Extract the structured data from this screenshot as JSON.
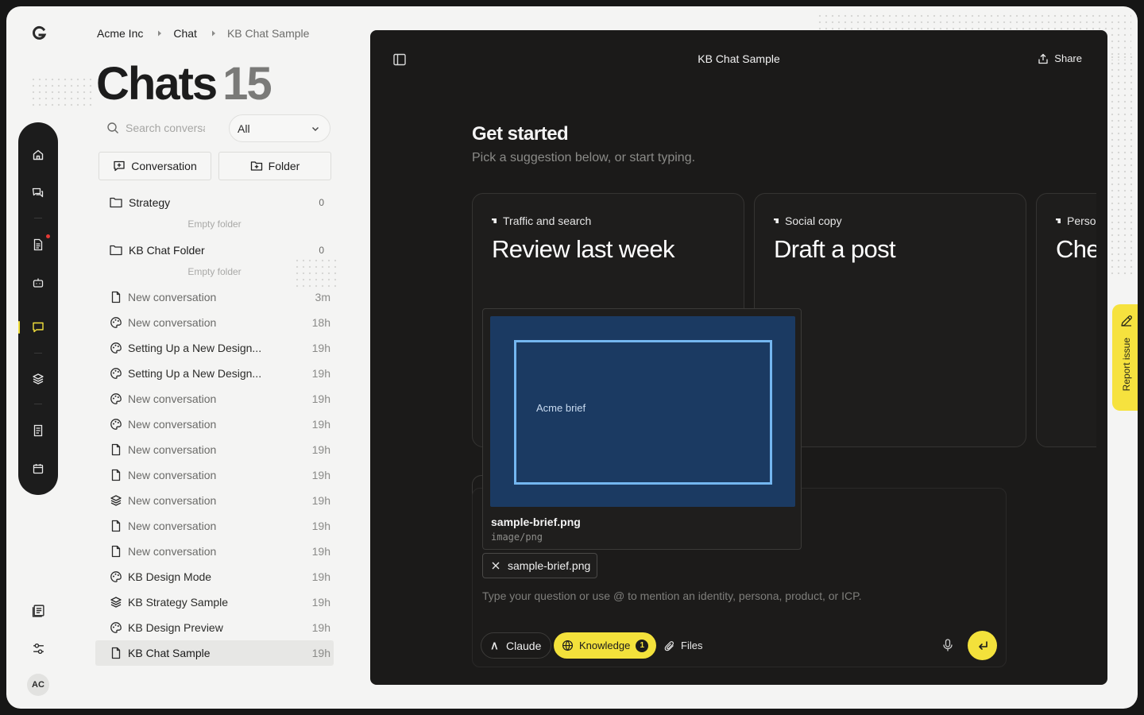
{
  "breadcrumb": {
    "org": "Acme Inc",
    "section": "Chat",
    "current": "KB Chat Sample"
  },
  "page": {
    "title": "Chats",
    "count": "15"
  },
  "search": {
    "placeholder": "Search conversations",
    "value": ""
  },
  "filter": {
    "selected": "All"
  },
  "buttons": {
    "conversation": "Conversation",
    "folder": "Folder"
  },
  "folders": [
    {
      "name": "Strategy",
      "count": "0",
      "empty_label": "Empty folder"
    },
    {
      "name": "KB Chat Folder",
      "count": "0",
      "empty_label": "Empty folder"
    }
  ],
  "conversations": [
    {
      "name": "New conversation",
      "time": "3m",
      "icon": "document-icon"
    },
    {
      "name": "New conversation",
      "time": "18h",
      "icon": "palette-icon"
    },
    {
      "name": "Setting Up a New Design...",
      "time": "19h",
      "icon": "palette-icon"
    },
    {
      "name": "Setting Up a New Design...",
      "time": "19h",
      "icon": "palette-icon"
    },
    {
      "name": "New conversation",
      "time": "19h",
      "icon": "palette-icon"
    },
    {
      "name": "New conversation",
      "time": "19h",
      "icon": "palette-icon"
    },
    {
      "name": "New conversation",
      "time": "19h",
      "icon": "document-icon"
    },
    {
      "name": "New conversation",
      "time": "19h",
      "icon": "document-icon"
    },
    {
      "name": "New conversation",
      "time": "19h",
      "icon": "layers-icon"
    },
    {
      "name": "New conversation",
      "time": "19h",
      "icon": "document-icon"
    },
    {
      "name": "New conversation",
      "time": "19h",
      "icon": "document-icon"
    },
    {
      "name": "KB Design Mode",
      "time": "19h",
      "icon": "palette-icon"
    },
    {
      "name": "KB Strategy Sample",
      "time": "19h",
      "icon": "layers-icon"
    },
    {
      "name": "KB Design Preview",
      "time": "19h",
      "icon": "palette-icon"
    },
    {
      "name": "KB Chat Sample",
      "time": "19h",
      "icon": "document-icon"
    }
  ],
  "user": {
    "initials": "AC"
  },
  "panel": {
    "title": "KB Chat Sample",
    "share_label": "Share",
    "get_started": "Get started",
    "subtitle": "Pick a suggestion below, or start typing.",
    "cards": [
      {
        "tag": "Traffic and search",
        "title": "Review last week"
      },
      {
        "tag": "Social copy",
        "title": "Draft a post"
      },
      {
        "tag": "Persona",
        "title": "Check"
      }
    ]
  },
  "attachment": {
    "file_name": "sample-brief.png",
    "mime": "image/png",
    "image_label": "Acme brief"
  },
  "composer": {
    "placeholder": "Type your question or use @ to mention an identity, persona, product, or ICP.",
    "model_label": "Claude",
    "knowledge_label": "Knowledge",
    "knowledge_count": "1",
    "files_label": "Files"
  },
  "report": {
    "label": "Report issue"
  },
  "colors": {
    "accent": "#f3e13b",
    "panel_bg": "#1b1a19",
    "page_bg": "#f4f4f3",
    "notification": "#e53935"
  }
}
